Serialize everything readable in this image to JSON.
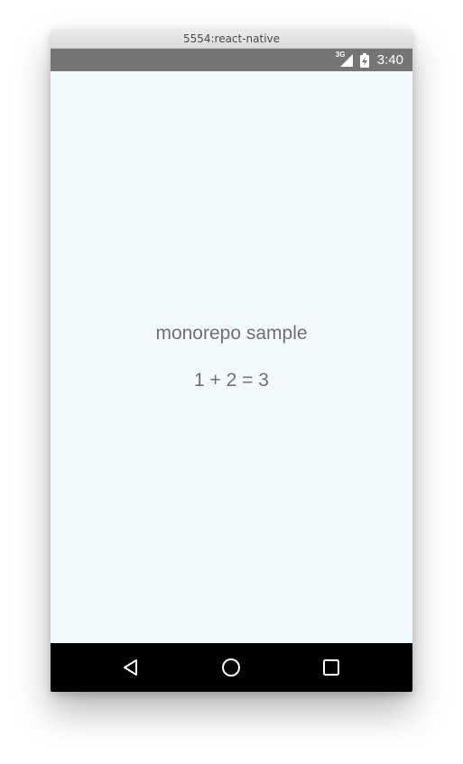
{
  "window": {
    "title": "5554:react-native"
  },
  "status_bar": {
    "network_type": "3G",
    "signal_icon": "cell-signal-icon",
    "battery_icon": "battery-charging-icon",
    "time": "3:40",
    "background_color": "#757575"
  },
  "app": {
    "background_color": "#f3fafe",
    "text_color": "#707070",
    "title": "monorepo sample",
    "equation": "1 + 2 = 3"
  },
  "nav_bar": {
    "back_icon": "back-triangle-icon",
    "home_icon": "home-circle-icon",
    "recents_icon": "recents-square-icon",
    "background_color": "#000000"
  }
}
